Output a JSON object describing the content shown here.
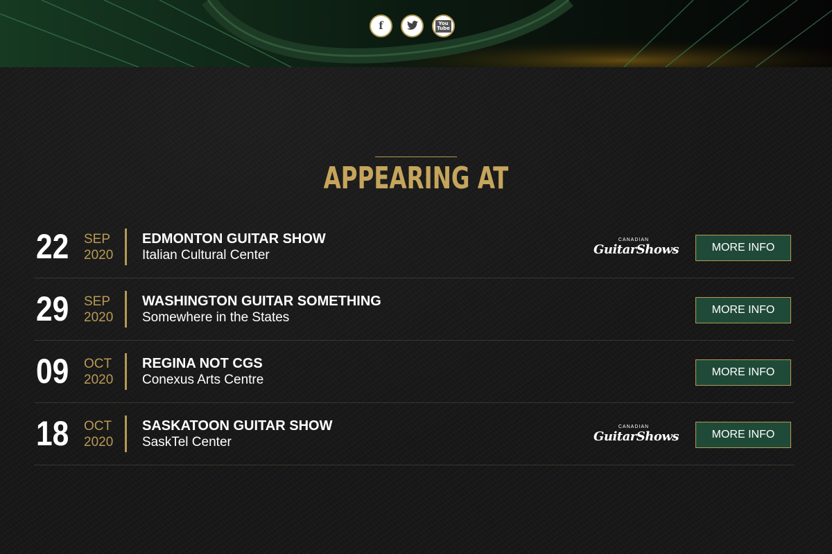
{
  "social": {
    "facebook": {
      "label": "f",
      "icon": "facebook-icon"
    },
    "twitter": {
      "label": "🐦",
      "icon": "twitter-icon"
    },
    "youtube": {
      "label": "You\nTube",
      "icon": "youtube-icon"
    }
  },
  "section": {
    "heading": "APPEARING AT"
  },
  "events": [
    {
      "day": "22",
      "month": "SEP",
      "year": "2020",
      "title": "EDMONTON GUITAR SHOW",
      "venue": "Italian Cultural Center",
      "has_sponsor_logo": true,
      "button_label": "MORE INFO"
    },
    {
      "day": "29",
      "month": "SEP",
      "year": "2020",
      "title": "WASHINGTON GUITAR SOMETHING",
      "venue": "Somewhere in the States",
      "has_sponsor_logo": false,
      "button_label": "MORE INFO"
    },
    {
      "day": "09",
      "month": "OCT",
      "year": "2020",
      "title": "REGINA NOT CGS",
      "venue": "Conexus Arts Centre",
      "has_sponsor_logo": false,
      "button_label": "MORE INFO"
    },
    {
      "day": "18",
      "month": "OCT",
      "year": "2020",
      "title": "SASKATOON GUITAR SHOW",
      "venue": "SaskTel Center",
      "has_sponsor_logo": true,
      "button_label": "MORE INFO"
    }
  ],
  "sponsor_logo": {
    "top_text": "CANADIAN",
    "script_text": "GuitarShows"
  },
  "colors": {
    "gold": "#c5a55c",
    "button_green": "#1f4a38",
    "background": "#161616"
  }
}
